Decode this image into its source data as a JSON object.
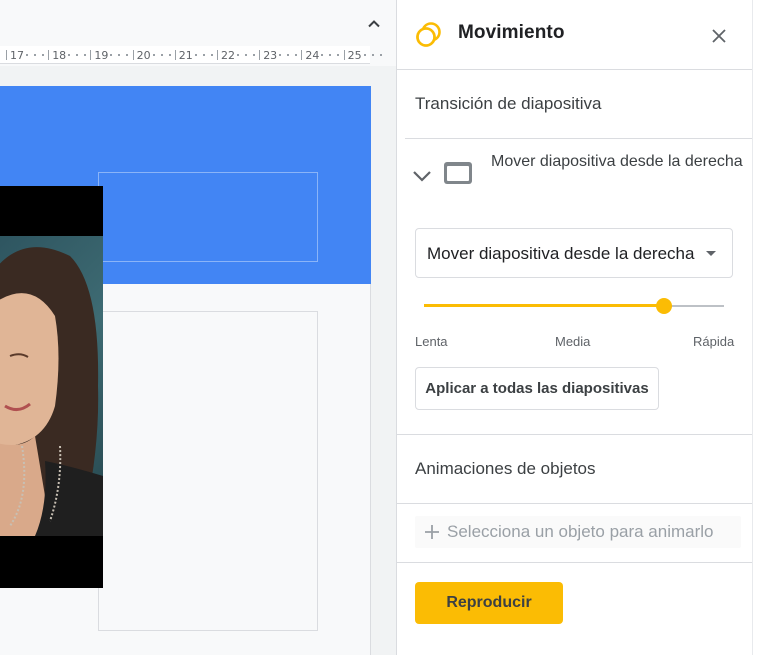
{
  "ruler": {
    "ticks": [
      "17",
      "18",
      "19",
      "20",
      "21",
      "22",
      "23",
      "24",
      "25"
    ]
  },
  "panel": {
    "title": "Movimiento",
    "icons": {
      "motion": "motion-icon",
      "close": "close-icon",
      "collapse": "chevron-up-icon"
    },
    "transition_section": {
      "title": "Transición de diapositiva",
      "current": "Mover diapositiva desde la derecha",
      "select_value": "Mover diapositiva desde la derecha",
      "speed": {
        "labels": [
          "Lenta",
          "Media",
          "Rápida"
        ],
        "value_fraction": 0.8
      },
      "apply_all_label": "Aplicar a todas las diapositivas"
    },
    "animations_section": {
      "title": "Animaciones de objetos",
      "select_object_label": "Selecciona un objeto para animarlo"
    },
    "play_label": "Reproducir"
  },
  "colors": {
    "accent": "#fbbc04",
    "slide_banner": "#4285f4"
  }
}
